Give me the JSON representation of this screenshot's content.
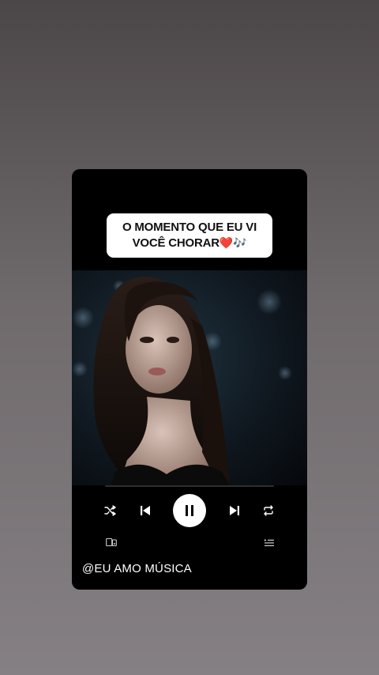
{
  "caption": {
    "line1": "O MOMENTO QUE EU VI",
    "line2": "VOCÊ CHORAR",
    "heart_emoji": "❤️",
    "notes_emoji": "🎶"
  },
  "player": {
    "progress": 0.0,
    "state": "playing",
    "controls": {
      "shuffle_icon": "shuffle-icon",
      "previous_icon": "skip-previous-icon",
      "pause_icon": "pause-icon",
      "next_icon": "skip-next-icon",
      "repeat_icon": "repeat-icon",
      "devices_icon": "connect-devices-icon",
      "queue_icon": "queue-icon"
    }
  },
  "handle": "@EU AMO MÚSICA",
  "colors": {
    "background_top": "#4b4647",
    "background_bottom": "#858083",
    "card": "#000000",
    "caption_bg": "#ffffff",
    "heart": "#e0102b",
    "notes": "#8b3fc9"
  }
}
